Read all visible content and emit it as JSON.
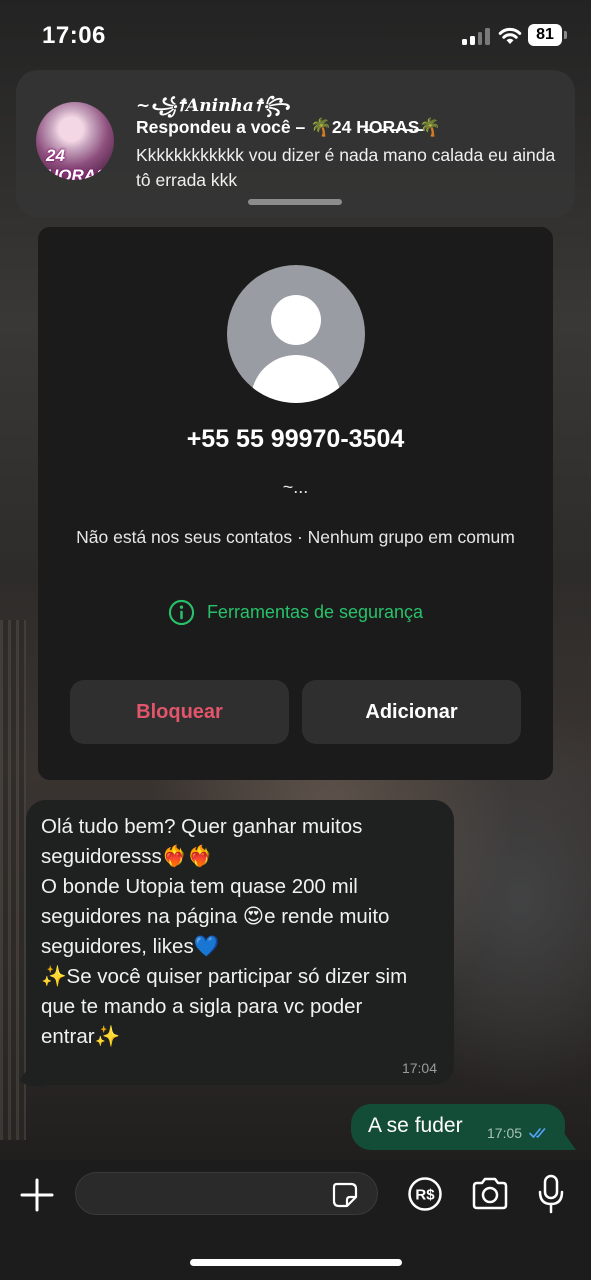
{
  "status_bar": {
    "time": "17:06",
    "battery": "81",
    "icons": [
      "signal-icon",
      "wifi-icon",
      "battery-icon"
    ]
  },
  "notification": {
    "sender": "~꧁☨︎𝑨𝒏𝒊𝒏𝒉𝒂☨︎꧂",
    "subtitle": "Respondeu a você – 🌴24 H̶O̶R̶A̶S̶🌴",
    "body": "Kkkkkkkkkkkk vou dizer é nada mano calada eu ainda tô errada kkk",
    "avatar_label": "24 HORAS"
  },
  "contact_card": {
    "phone": "+55 55 99970-3504",
    "name": "~...",
    "info": "Não está nos seus contatos · Nenhum grupo em comum",
    "safety_tools": "Ferramentas de segurança",
    "block_label": "Bloquear",
    "add_label": "Adicionar"
  },
  "messages": [
    {
      "direction": "incoming",
      "text": "Olá tudo bem? Quer ganhar muitos seguidoresss❤️‍🔥❤️‍🔥\nO bonde Utopia tem quase 200 mil seguidores na página 😍e rende muito seguidores, likes💙\n✨Se você quiser participar só dizer sim\nque te mando a sigla para vc poder entrar✨",
      "time": "17:04"
    },
    {
      "direction": "outgoing",
      "text": "A se fuder",
      "time": "17:05",
      "status": "read"
    }
  ],
  "input_bar": {
    "icons": [
      "plus-icon",
      "sticker-icon",
      "pix-icon",
      "camera-icon",
      "microphone-icon"
    ],
    "pix_label": "R$"
  },
  "colors": {
    "accent_green": "#28c16a",
    "block_red": "#e2556a",
    "outgoing_bubble": "#134d37",
    "incoming_bubble": "#1f2020"
  }
}
